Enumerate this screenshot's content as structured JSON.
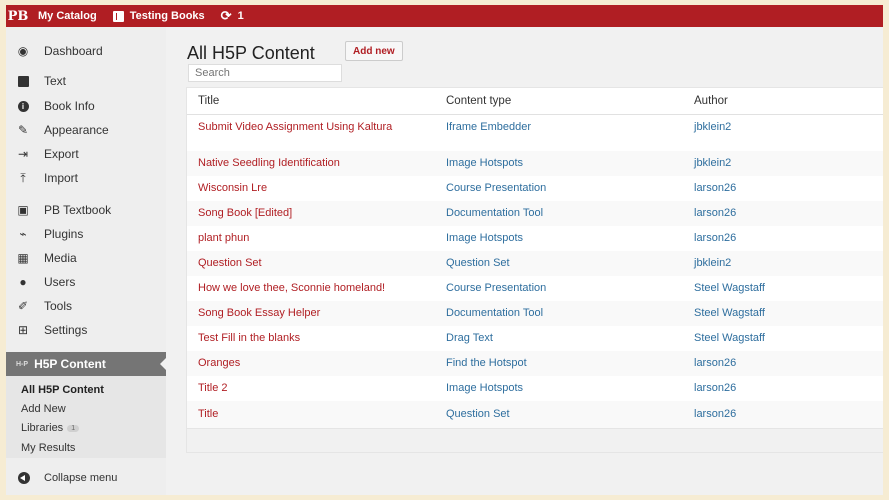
{
  "adminbar": {
    "logo": "PB",
    "catalog": "My Catalog",
    "book": "Testing Books",
    "updates_count": "1"
  },
  "sidebar": {
    "items": [
      {
        "label": "Dashboard",
        "icon": "dashboard-icon"
      },
      {
        "label": "Text",
        "icon": "text-icon"
      },
      {
        "label": "Book Info",
        "icon": "info-icon"
      },
      {
        "label": "Appearance",
        "icon": "appearance-icon"
      },
      {
        "label": "Export",
        "icon": "export-icon"
      },
      {
        "label": "Import",
        "icon": "import-icon"
      },
      {
        "label": "PB Textbook",
        "icon": "textbook-icon"
      },
      {
        "label": "Plugins",
        "icon": "plugins-icon"
      },
      {
        "label": "Media",
        "icon": "media-icon"
      },
      {
        "label": "Users",
        "icon": "users-icon"
      },
      {
        "label": "Tools",
        "icon": "tools-icon"
      },
      {
        "label": "Settings",
        "icon": "settings-icon"
      }
    ],
    "active": {
      "badge": "H-P",
      "label": "H5P Content"
    },
    "submenu": [
      {
        "label": "All H5P Content"
      },
      {
        "label": "Add New"
      },
      {
        "label": "Libraries",
        "count": "1"
      },
      {
        "label": "My Results"
      }
    ],
    "collapse": "Collapse menu"
  },
  "main": {
    "title": "All H5P Content",
    "add_new": "Add new",
    "search_placeholder": "Search",
    "columns": [
      "Title",
      "Content type",
      "Author"
    ],
    "rows": [
      {
        "title": "Submit Video Assignment Using Kaltura",
        "type": "Iframe Embedder",
        "author": "jbklein2"
      },
      {
        "title": "Native Seedling Identification",
        "type": "Image Hotspots",
        "author": "jbklein2"
      },
      {
        "title": "Wisconsin Lre",
        "type": "Course Presentation",
        "author": "larson26"
      },
      {
        "title": "Song Book [Edited]",
        "type": "Documentation Tool",
        "author": "larson26"
      },
      {
        "title": "plant phun",
        "type": "Image Hotspots",
        "author": "larson26"
      },
      {
        "title": "Question Set",
        "type": "Question Set",
        "author": "jbklein2"
      },
      {
        "title": "How we love thee, Sconnie homeland!",
        "type": "Course Presentation",
        "author": "Steel Wagstaff"
      },
      {
        "title": "Song Book Essay Helper",
        "type": "Documentation Tool",
        "author": "Steel Wagstaff"
      },
      {
        "title": "Test Fill in the blanks",
        "type": "Drag Text",
        "author": "Steel Wagstaff"
      },
      {
        "title": "Oranges",
        "type": "Find the Hotspot",
        "author": "larson26"
      },
      {
        "title": "Title 2",
        "type": "Image Hotspots",
        "author": "larson26"
      },
      {
        "title": "Title",
        "type": "Question Set",
        "author": "larson26"
      }
    ]
  },
  "colors": {
    "brand": "#b01e23",
    "link": "#2e6e9e",
    "active_menu": "#757575"
  }
}
